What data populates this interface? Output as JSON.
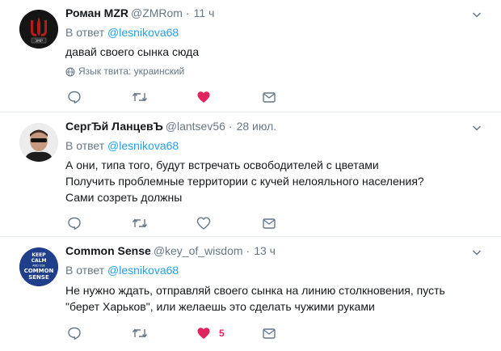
{
  "tweets": [
    {
      "author": "Роман MZR",
      "handle": "@ZMRom",
      "sep": "·",
      "time": "11 ч",
      "reply_prefix": "В ответ",
      "reply_mention": "@lesnikova68",
      "lines": [
        "давай своего сынка сюда"
      ],
      "language": "Язык твита: украинский",
      "liked": true,
      "like_count": ""
    },
    {
      "author": "СергЂй ЛанцевЪ",
      "handle": "@lantsev56",
      "sep": "·",
      "time": "28 июл.",
      "reply_prefix": "В ответ",
      "reply_mention": "@lesnikova68",
      "lines": [
        "А они, типа того, будут встречать освободителей с цветами",
        "Получить проблемные территории с кучей нелояльного населения?",
        "Сами созреть должны"
      ],
      "liked": false,
      "like_count": ""
    },
    {
      "author": "Common Sense",
      "handle": "@key_of_wisdom",
      "sep": "·",
      "time": "13 ч",
      "reply_prefix": "В ответ",
      "reply_mention": "@lesnikova68",
      "lines": [
        "Не нужно ждать, отправляй своего сынка на линию столкновения, пусть",
        "\"берет Харьков\", или желаешь это сделать чужими руками"
      ],
      "liked": true,
      "like_count": "5",
      "avatar_text": [
        "KEEP",
        "CALM",
        "AND USE",
        "COMMON",
        "SENSE"
      ]
    }
  ],
  "colors": {
    "accent": "#1da1f2",
    "like": "#e0245e",
    "muted": "#657786",
    "icon": "#657786"
  },
  "icons": [
    "reply-icon",
    "retweet-icon",
    "like-icon",
    "message-icon",
    "chevron-down-icon",
    "globe-icon"
  ]
}
